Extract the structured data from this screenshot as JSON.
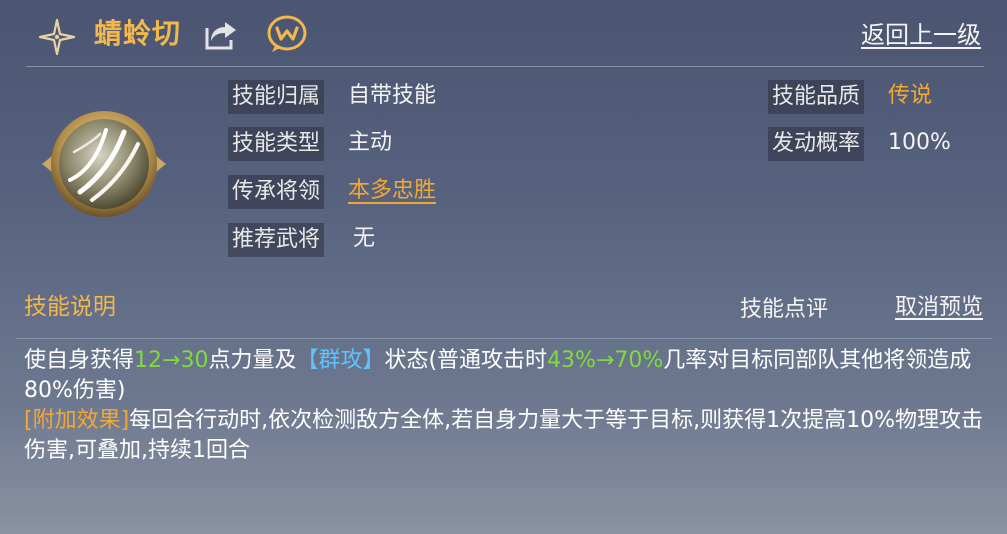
{
  "header": {
    "title": "蜻蛉切",
    "back_label": "返回上一级"
  },
  "icons": {
    "star": "four-point-star-icon",
    "share": "share-icon",
    "chat": "chat-bubble-icon",
    "skill": "skill-slash-icon"
  },
  "attributes": {
    "owner_label": "技能归属",
    "owner_value": "自带技能",
    "type_label": "技能类型",
    "type_value": "主动",
    "inherit_label": "传承将领",
    "inherit_value": "本多忠胜",
    "recommend_label": "推荐武将",
    "recommend_value": "无",
    "quality_label": "技能品质",
    "quality_value": "传说",
    "chance_label": "发动概率",
    "chance_value": "100%"
  },
  "description": {
    "title": "技能说明",
    "review_label": "技能点评",
    "cancel_label": "取消预览",
    "line1_a": "使自身获得",
    "line1_b": "12→30",
    "line1_c": "点力量及",
    "line1_d": "【群攻】",
    "line1_e": "状态(普通攻击时",
    "line1_f": "43%→70%",
    "line1_g": "几率对目标同部队其他将领造成80%伤害)",
    "extra_tag": "[附加效果]",
    "extra_text": "每回合行动时,依次检测敌方全体,若自身力量大于等于目标,则获得1次提高10%物理攻击伤害,可叠加,持续1回合"
  },
  "colors": {
    "title_gold": "#f2b84b",
    "value_orange": "#f3a931",
    "highlight_green": "#7fdc3c",
    "highlight_blue": "#5ec3ff"
  }
}
